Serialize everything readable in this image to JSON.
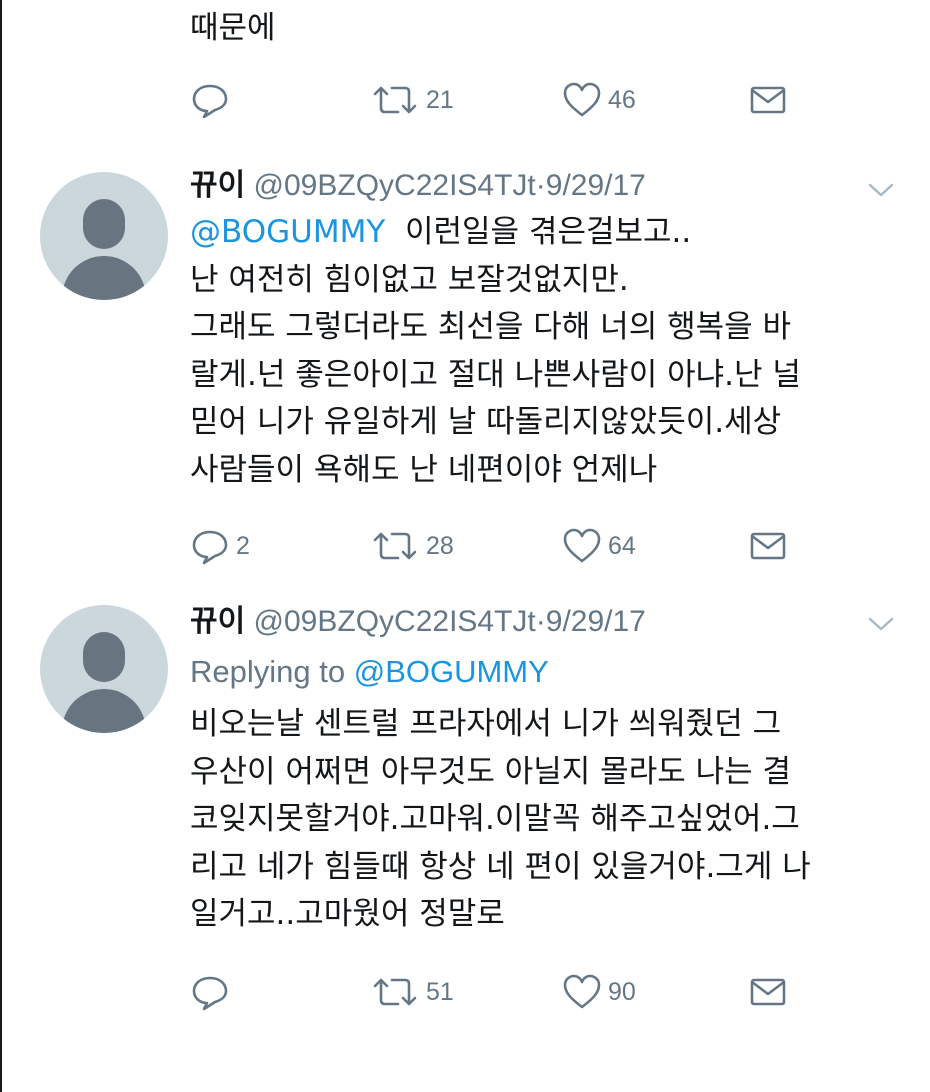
{
  "colors": {
    "link": "#1b95e0",
    "secondary": "#657786",
    "text": "#14171a",
    "avatar_bg": "#ccd6dd"
  },
  "icons": {
    "reply": "reply-icon",
    "retweet": "retweet-icon",
    "like": "heart-icon",
    "dm": "envelope-icon",
    "menu": "chevron-down-icon"
  },
  "prev_tweet": {
    "text_tail": "때문에",
    "actions": {
      "reply": "",
      "retweet": "21",
      "like": "46"
    }
  },
  "tweets": [
    {
      "name": "뀨이",
      "handle": "@09BZQyC22IS4TJt",
      "separator": "·",
      "date": "9/29/17",
      "mention": "@BOGUMMY",
      "lines": [
        "이런일을 겪은걸보고..",
        "난 여전히 힘이없고 보잘것없지만.",
        "그래도 그렇더라도 최선을 다해 너의 행복을 바",
        "랄게.넌 좋은아이고 절대 나쁜사람이 아냐.난 널",
        "믿어 니가 유일하게 날 따돌리지않았듯이.세상",
        "사람들이 욕해도 난 네편이야 언제나"
      ],
      "actions": {
        "reply": "2",
        "retweet": "28",
        "like": "64"
      }
    },
    {
      "name": "뀨이",
      "handle": "@09BZQyC22IS4TJt",
      "separator": "·",
      "date": "9/29/17",
      "replying_prefix": "Replying to",
      "replying_to": "@BOGUMMY",
      "lines": [
        "비오는날 센트럴  프라자에서 니가 씌워줬던 그",
        "우산이 어쩌면 아무것도 아닐지 몰라도 나는 결",
        "코잊지못할거야.고마워.이말꼭 해주고싶었어.그",
        "리고 네가 힘들때 항상 네 편이 있을거야.그게 나",
        "일거고..고마웠어 정말로"
      ],
      "actions": {
        "reply": "",
        "retweet": "51",
        "like": "90"
      }
    }
  ]
}
